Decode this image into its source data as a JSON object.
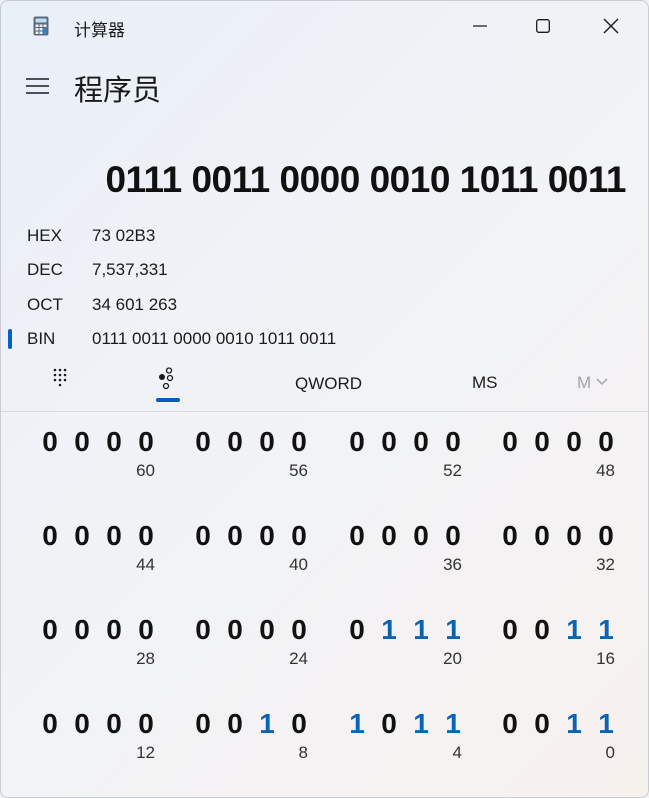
{
  "window": {
    "title": "计算器",
    "icon": "calculator-icon"
  },
  "header": {
    "menu_icon": "hamburger-menu-icon",
    "mode_title": "程序员"
  },
  "display": {
    "value": "0111 0011 0000 0010 1011 0011"
  },
  "radix": [
    {
      "label": "HEX",
      "value": "73 02B3",
      "selected": false
    },
    {
      "label": "DEC",
      "value": "7,537,331",
      "selected": false
    },
    {
      "label": "OCT",
      "value": "34 601 263",
      "selected": false
    },
    {
      "label": "BIN",
      "value": "0111 0011 0000 0010 1011 0011",
      "selected": true
    }
  ],
  "toolbar": {
    "keypad_icon": "full-keypad-icon",
    "bits_icon": "bit-toggling-keypad-icon",
    "word_size": "QWORD",
    "ms_label": "MS",
    "memory_label": "M",
    "memory_chevron": "chevron-down-icon"
  },
  "accent_color": "#0560c2",
  "bit_on_color": "#0b63b5",
  "bit_grid": [
    {
      "bits": [
        "0",
        "0",
        "0",
        "0"
      ],
      "position": "60"
    },
    {
      "bits": [
        "0",
        "0",
        "0",
        "0"
      ],
      "position": "56"
    },
    {
      "bits": [
        "0",
        "0",
        "0",
        "0"
      ],
      "position": "52"
    },
    {
      "bits": [
        "0",
        "0",
        "0",
        "0"
      ],
      "position": "48"
    },
    {
      "bits": [
        "0",
        "0",
        "0",
        "0"
      ],
      "position": "44"
    },
    {
      "bits": [
        "0",
        "0",
        "0",
        "0"
      ],
      "position": "40"
    },
    {
      "bits": [
        "0",
        "0",
        "0",
        "0"
      ],
      "position": "36"
    },
    {
      "bits": [
        "0",
        "0",
        "0",
        "0"
      ],
      "position": "32"
    },
    {
      "bits": [
        "0",
        "0",
        "0",
        "0"
      ],
      "position": "28"
    },
    {
      "bits": [
        "0",
        "0",
        "0",
        "0"
      ],
      "position": "24"
    },
    {
      "bits": [
        "0",
        "1",
        "1",
        "1"
      ],
      "position": "20"
    },
    {
      "bits": [
        "0",
        "0",
        "1",
        "1"
      ],
      "position": "16"
    },
    {
      "bits": [
        "0",
        "0",
        "0",
        "0"
      ],
      "position": "12"
    },
    {
      "bits": [
        "0",
        "0",
        "1",
        "0"
      ],
      "position": "8"
    },
    {
      "bits": [
        "1",
        "0",
        "1",
        "1"
      ],
      "position": "4"
    },
    {
      "bits": [
        "0",
        "0",
        "1",
        "1"
      ],
      "position": "0"
    }
  ]
}
